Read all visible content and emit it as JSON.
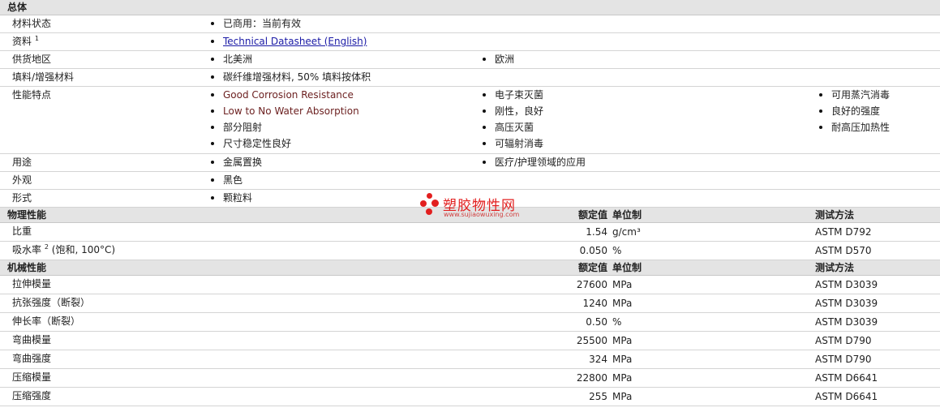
{
  "general": {
    "title": "总体",
    "rows": {
      "material_status": {
        "label": "材料状态",
        "value": "已商用：当前有效"
      },
      "documents": {
        "label": "资料",
        "sup": "1",
        "link": "Technical Datasheet (English)"
      },
      "availability": {
        "label": "供货地区",
        "col1": "北美洲",
        "col2": "欧洲"
      },
      "filler": {
        "label": "填料/增强材料",
        "value": "碳纤维增强材料, 50% 填料按体积"
      },
      "features": {
        "label": "性能特点",
        "col1": [
          "Good Corrosion Resistance",
          "Low to No Water Absorption",
          "部分阻射",
          "尺寸稳定性良好"
        ],
        "col2": [
          "电子束灭菌",
          "刚性，良好",
          "高压灭菌",
          "可辐射消毒"
        ],
        "col3": [
          "可用蒸汽消毒",
          "良好的强度",
          "耐高压加热性"
        ]
      },
      "uses": {
        "label": "用途",
        "col1": "金属置换",
        "col2": "医疗/护理领域的应用"
      },
      "appearance": {
        "label": "外观",
        "value": "黑色"
      },
      "form": {
        "label": "形式",
        "value": "颗粒料"
      }
    }
  },
  "physical": {
    "title": "物理性能",
    "headers": {
      "nominal": "额定值",
      "unit": "单位制",
      "method": "测试方法"
    },
    "rows": [
      {
        "label": "比重",
        "value": "1.54",
        "unit": "g/cm³",
        "method": "ASTM D792"
      },
      {
        "label": "吸水率",
        "sup": "2",
        "label_suffix": "(饱和, 100°C)",
        "value": "0.050",
        "unit": "%",
        "method": "ASTM D570"
      }
    ]
  },
  "mechanical": {
    "title": "机械性能",
    "headers": {
      "nominal": "额定值",
      "unit": "单位制",
      "method": "测试方法"
    },
    "rows": [
      {
        "label": "拉伸模量",
        "value": "27600",
        "unit": "MPa",
        "method": "ASTM D3039"
      },
      {
        "label": "抗张强度（断裂）",
        "value": "1240",
        "unit": "MPa",
        "method": "ASTM D3039"
      },
      {
        "label": "伸长率（断裂）",
        "value": "0.50",
        "unit": "%",
        "method": "ASTM D3039"
      },
      {
        "label": "弯曲模量",
        "value": "25500",
        "unit": "MPa",
        "method": "ASTM D790"
      },
      {
        "label": "弯曲强度",
        "value": "324",
        "unit": "MPa",
        "method": "ASTM D790"
      },
      {
        "label": "压缩模量",
        "value": "22800",
        "unit": "MPa",
        "method": "ASTM D6641"
      },
      {
        "label": "压缩强度",
        "value": "255",
        "unit": "MPa",
        "method": "ASTM D6641"
      }
    ]
  },
  "watermark": {
    "name": "塑胶物性网",
    "url": "www.sujiaowuxing.com",
    "color": "#e21f1f"
  }
}
